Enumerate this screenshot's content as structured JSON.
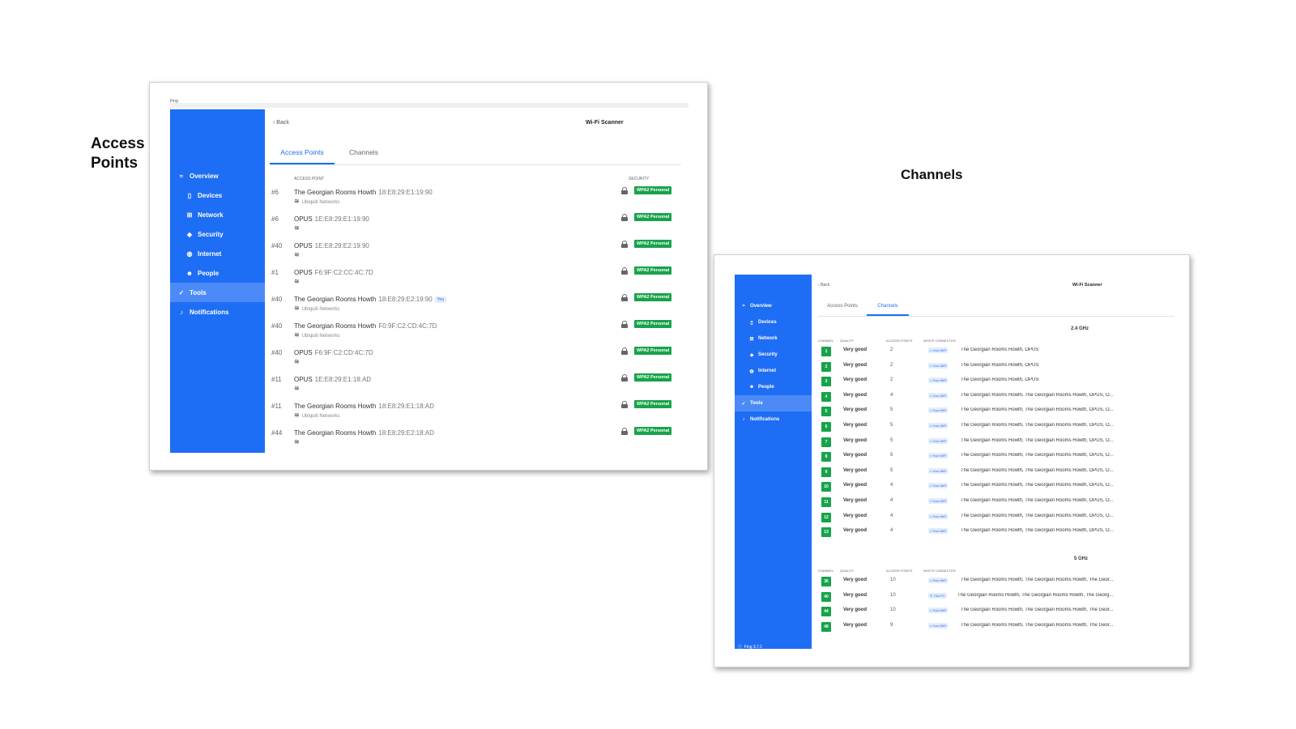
{
  "captions": {
    "access_points": "Access\nPoints",
    "channels": "Channels"
  },
  "app": {
    "title": "Wi-Fi Scanner",
    "back": "Back",
    "tabs": [
      "Access Points",
      "Channels"
    ],
    "nav": [
      {
        "label": "Overview",
        "icon": "wifi-icon"
      },
      {
        "label": "Devices",
        "icon": "phone-icon"
      },
      {
        "label": "Network",
        "icon": "network-icon"
      },
      {
        "label": "Security",
        "icon": "shield-icon"
      },
      {
        "label": "Internet",
        "icon": "globe-icon"
      },
      {
        "label": "People",
        "icon": "people-icon"
      },
      {
        "label": "Tools",
        "icon": "check-circle-icon",
        "active": true
      },
      {
        "label": "Notifications",
        "icon": "bell-icon"
      }
    ],
    "colors": {
      "sidebar": "#1e6df5",
      "badge_green": "#17a34a",
      "accent": "#1e6df5"
    }
  },
  "ap_screen": {
    "truncated_top_text": "Fing",
    "headers": {
      "access_point": "ACCESS POINT",
      "security": "SECURITY"
    },
    "rows": [
      {
        "channel": "#6",
        "name": "The Georgian Rooms Howth",
        "mac": "18:E8:29:E1:19:90",
        "vendor": "Ubiquiti Networks",
        "you": "",
        "security": "WPA2 Personal"
      },
      {
        "channel": "#6",
        "name": "OPUS",
        "mac": "1E:E8:29:E1:19:90",
        "vendor": "",
        "you": "",
        "security": "WPA2 Personal"
      },
      {
        "channel": "#40",
        "name": "OPUS",
        "mac": "1E:E8:29:E2:19:90",
        "vendor": "",
        "you": "",
        "security": "WPA2 Personal"
      },
      {
        "channel": "#1",
        "name": "OPUS",
        "mac": "F6:9F:C2:CC:4C:7D",
        "vendor": "",
        "you": "",
        "security": "WPA2 Personal"
      },
      {
        "channel": "#40",
        "name": "The Georgian Rooms Howth",
        "mac": "18:E8:29:E2:19:90",
        "vendor": "Ubiquiti Networks",
        "you": "You",
        "security": "WPA2 Personal"
      },
      {
        "channel": "#40",
        "name": "The Georgian Rooms Howth",
        "mac": "F0:9F:C2:CD:4C:7D",
        "vendor": "Ubiquiti Networks",
        "you": "",
        "security": "WPA2 Personal"
      },
      {
        "channel": "#40",
        "name": "OPUS",
        "mac": "F6:9F:C2:CD:4C:7D",
        "vendor": "",
        "you": "",
        "security": "WPA2 Personal"
      },
      {
        "channel": "#11",
        "name": "OPUS",
        "mac": "1E:E8:29:E1:18:AD",
        "vendor": "",
        "you": "",
        "security": "WPA2 Personal"
      },
      {
        "channel": "#11",
        "name": "The Georgian Rooms Howth",
        "mac": "18:E8:29:E1:18:AD",
        "vendor": "Ubiquiti Networks",
        "you": "",
        "security": "WPA2 Personal"
      },
      {
        "channel": "#44",
        "name": "The Georgian Rooms Howth",
        "mac": "18:E8:29:E2:18:AD",
        "vendor": "",
        "you": "",
        "security": "WPA2 Personal"
      }
    ]
  },
  "ch_screen": {
    "headers": {
      "channel": "CHANNEL",
      "quality": "QUALITY",
      "aps": "ACCESS POINTS",
      "who": "WHO'S CONNECTED"
    },
    "footer_version": "Fing 3.7.1",
    "bands": [
      {
        "name": "2.4 GHz",
        "rows": [
          {
            "ch": "1",
            "quality": "Very good",
            "aps": "2",
            "tag": "Your WiFi",
            "who": "The Georgian Rooms Howth, OPUS"
          },
          {
            "ch": "2",
            "quality": "Very good",
            "aps": "2",
            "tag": "Your WiFi",
            "who": "The Georgian Rooms Howth, OPUS"
          },
          {
            "ch": "3",
            "quality": "Very good",
            "aps": "2",
            "tag": "Your WiFi",
            "who": "The Georgian Rooms Howth, OPUS"
          },
          {
            "ch": "4",
            "quality": "Very good",
            "aps": "4",
            "tag": "Your WiFi",
            "who": "The Georgian Rooms Howth, The Georgian Rooms Howth, OPUS, O..."
          },
          {
            "ch": "5",
            "quality": "Very good",
            "aps": "5",
            "tag": "Your WiFi",
            "who": "The Georgian Rooms Howth, The Georgian Rooms Howth, OPUS, O..."
          },
          {
            "ch": "6",
            "quality": "Very good",
            "aps": "5",
            "tag": "Your WiFi",
            "who": "The Georgian Rooms Howth, The Georgian Rooms Howth, OPUS, O..."
          },
          {
            "ch": "7",
            "quality": "Very good",
            "aps": "5",
            "tag": "Your WiFi",
            "who": "The Georgian Rooms Howth, The Georgian Rooms Howth, OPUS, O..."
          },
          {
            "ch": "8",
            "quality": "Very good",
            "aps": "5",
            "tag": "Your WiFi",
            "who": "The Georgian Rooms Howth, The Georgian Rooms Howth, OPUS, O..."
          },
          {
            "ch": "9",
            "quality": "Very good",
            "aps": "5",
            "tag": "Your WiFi",
            "who": "The Georgian Rooms Howth, The Georgian Rooms Howth, OPUS, O..."
          },
          {
            "ch": "10",
            "quality": "Very good",
            "aps": "4",
            "tag": "Your WiFi",
            "who": "The Georgian Rooms Howth, The Georgian Rooms Howth, OPUS, O..."
          },
          {
            "ch": "11",
            "quality": "Very good",
            "aps": "4",
            "tag": "Your WiFi",
            "who": "The Georgian Rooms Howth, The Georgian Rooms Howth, OPUS, O..."
          },
          {
            "ch": "12",
            "quality": "Very good",
            "aps": "4",
            "tag": "Your WiFi",
            "who": "The Georgian Rooms Howth, The Georgian Rooms Howth, OPUS, O..."
          },
          {
            "ch": "13",
            "quality": "Very good",
            "aps": "4",
            "tag": "Your WiFi",
            "who": "The Georgian Rooms Howth, The Georgian Rooms Howth, OPUS, O..."
          }
        ]
      },
      {
        "name": "5 GHz",
        "rows": [
          {
            "ch": "36",
            "quality": "Very good",
            "aps": "10",
            "tag": "Your WiFi",
            "who": "The Georgian Rooms Howth, The Georgian Rooms Howth, The Geor..."
          },
          {
            "ch": "40",
            "quality": "Very good",
            "aps": "10",
            "tag": "This PC",
            "who": "The Georgian Rooms Howth, The Georgian Rooms Howth, The Georg..."
          },
          {
            "ch": "44",
            "quality": "Very good",
            "aps": "10",
            "tag": "Your WiFi",
            "who": "The Georgian Rooms Howth, The Georgian Rooms Howth, The Geor..."
          },
          {
            "ch": "48",
            "quality": "Very good",
            "aps": "9",
            "tag": "Your WiFi",
            "who": "The Georgian Rooms Howth, The Georgian Rooms Howth, The Geor..."
          }
        ]
      }
    ]
  }
}
